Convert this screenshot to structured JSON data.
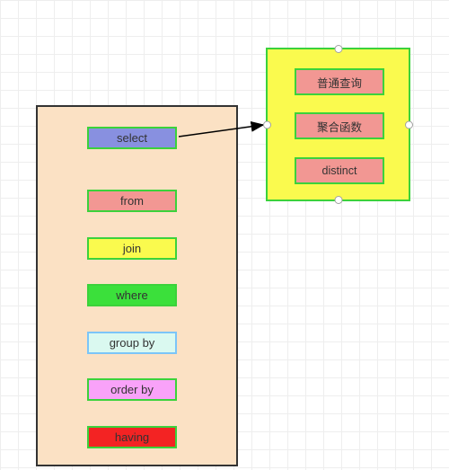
{
  "chart_data": {
    "type": "diagram",
    "title": "",
    "main_box": {
      "items": [
        {
          "label": "select",
          "color": "#8890e0"
        },
        {
          "label": "from",
          "color": "#f29793"
        },
        {
          "label": "join",
          "color": "#fafa4e"
        },
        {
          "label": "where",
          "color": "#3be03b"
        },
        {
          "label": "group by",
          "color": "#daf9f0"
        },
        {
          "label": "order by",
          "color": "#f9a2f9"
        },
        {
          "label": "having",
          "color": "#f32323"
        }
      ]
    },
    "detail_box": {
      "selected": true,
      "items": [
        {
          "label": "普通查询"
        },
        {
          "label": "聚合函数"
        },
        {
          "label": "distinct"
        }
      ]
    },
    "arrow": {
      "from": "select",
      "to": "detail_box"
    }
  },
  "sql": {
    "select": "select",
    "from": "from",
    "join": "join",
    "where": "where",
    "groupby": "group by",
    "orderby": "order by",
    "having": "having"
  },
  "detail": {
    "i0": "普通查询",
    "i1": "聚合函数",
    "i2": "distinct"
  }
}
